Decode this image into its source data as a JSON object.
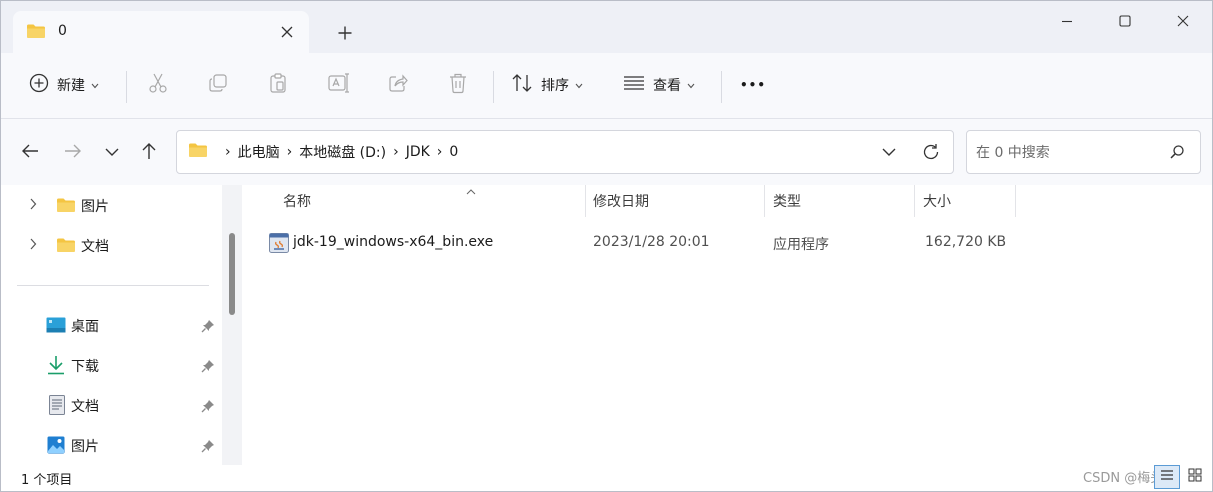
{
  "tab": {
    "title": "0",
    "new_tab_symbol": "+"
  },
  "toolbar": {
    "new_label": "新建",
    "sort_label": "排序",
    "view_label": "查看",
    "more_symbol": "•••"
  },
  "address": {
    "crumbs": [
      "此电脑",
      "本地磁盘 (D:)",
      "JDK",
      "0"
    ],
    "separator": "›"
  },
  "search": {
    "placeholder": "在 0 中搜索"
  },
  "sidebar": {
    "tree": [
      {
        "label": "图片",
        "icon": "folder-icon"
      },
      {
        "label": "文档",
        "icon": "folder-icon"
      }
    ],
    "quick_access": [
      {
        "label": "桌面",
        "icon": "desktop-icon"
      },
      {
        "label": "下载",
        "icon": "download-icon"
      },
      {
        "label": "文档",
        "icon": "document-icon"
      },
      {
        "label": "图片",
        "icon": "pictures-icon"
      }
    ]
  },
  "columns": {
    "name": "名称",
    "modified": "修改日期",
    "type": "类型",
    "size": "大小"
  },
  "files": [
    {
      "name": "jdk-19_windows-x64_bin.exe",
      "modified": "2023/1/28 20:01",
      "type": "应用程序",
      "size": "162,720 KB",
      "icon": "installer-icon"
    }
  ],
  "status": {
    "count": "1 个项目",
    "watermark": "CSDN @梅头脑"
  },
  "colors": {
    "folder": "#f4c542",
    "accent": "#1a73e8",
    "icon_gray": "#5f5f5f"
  }
}
